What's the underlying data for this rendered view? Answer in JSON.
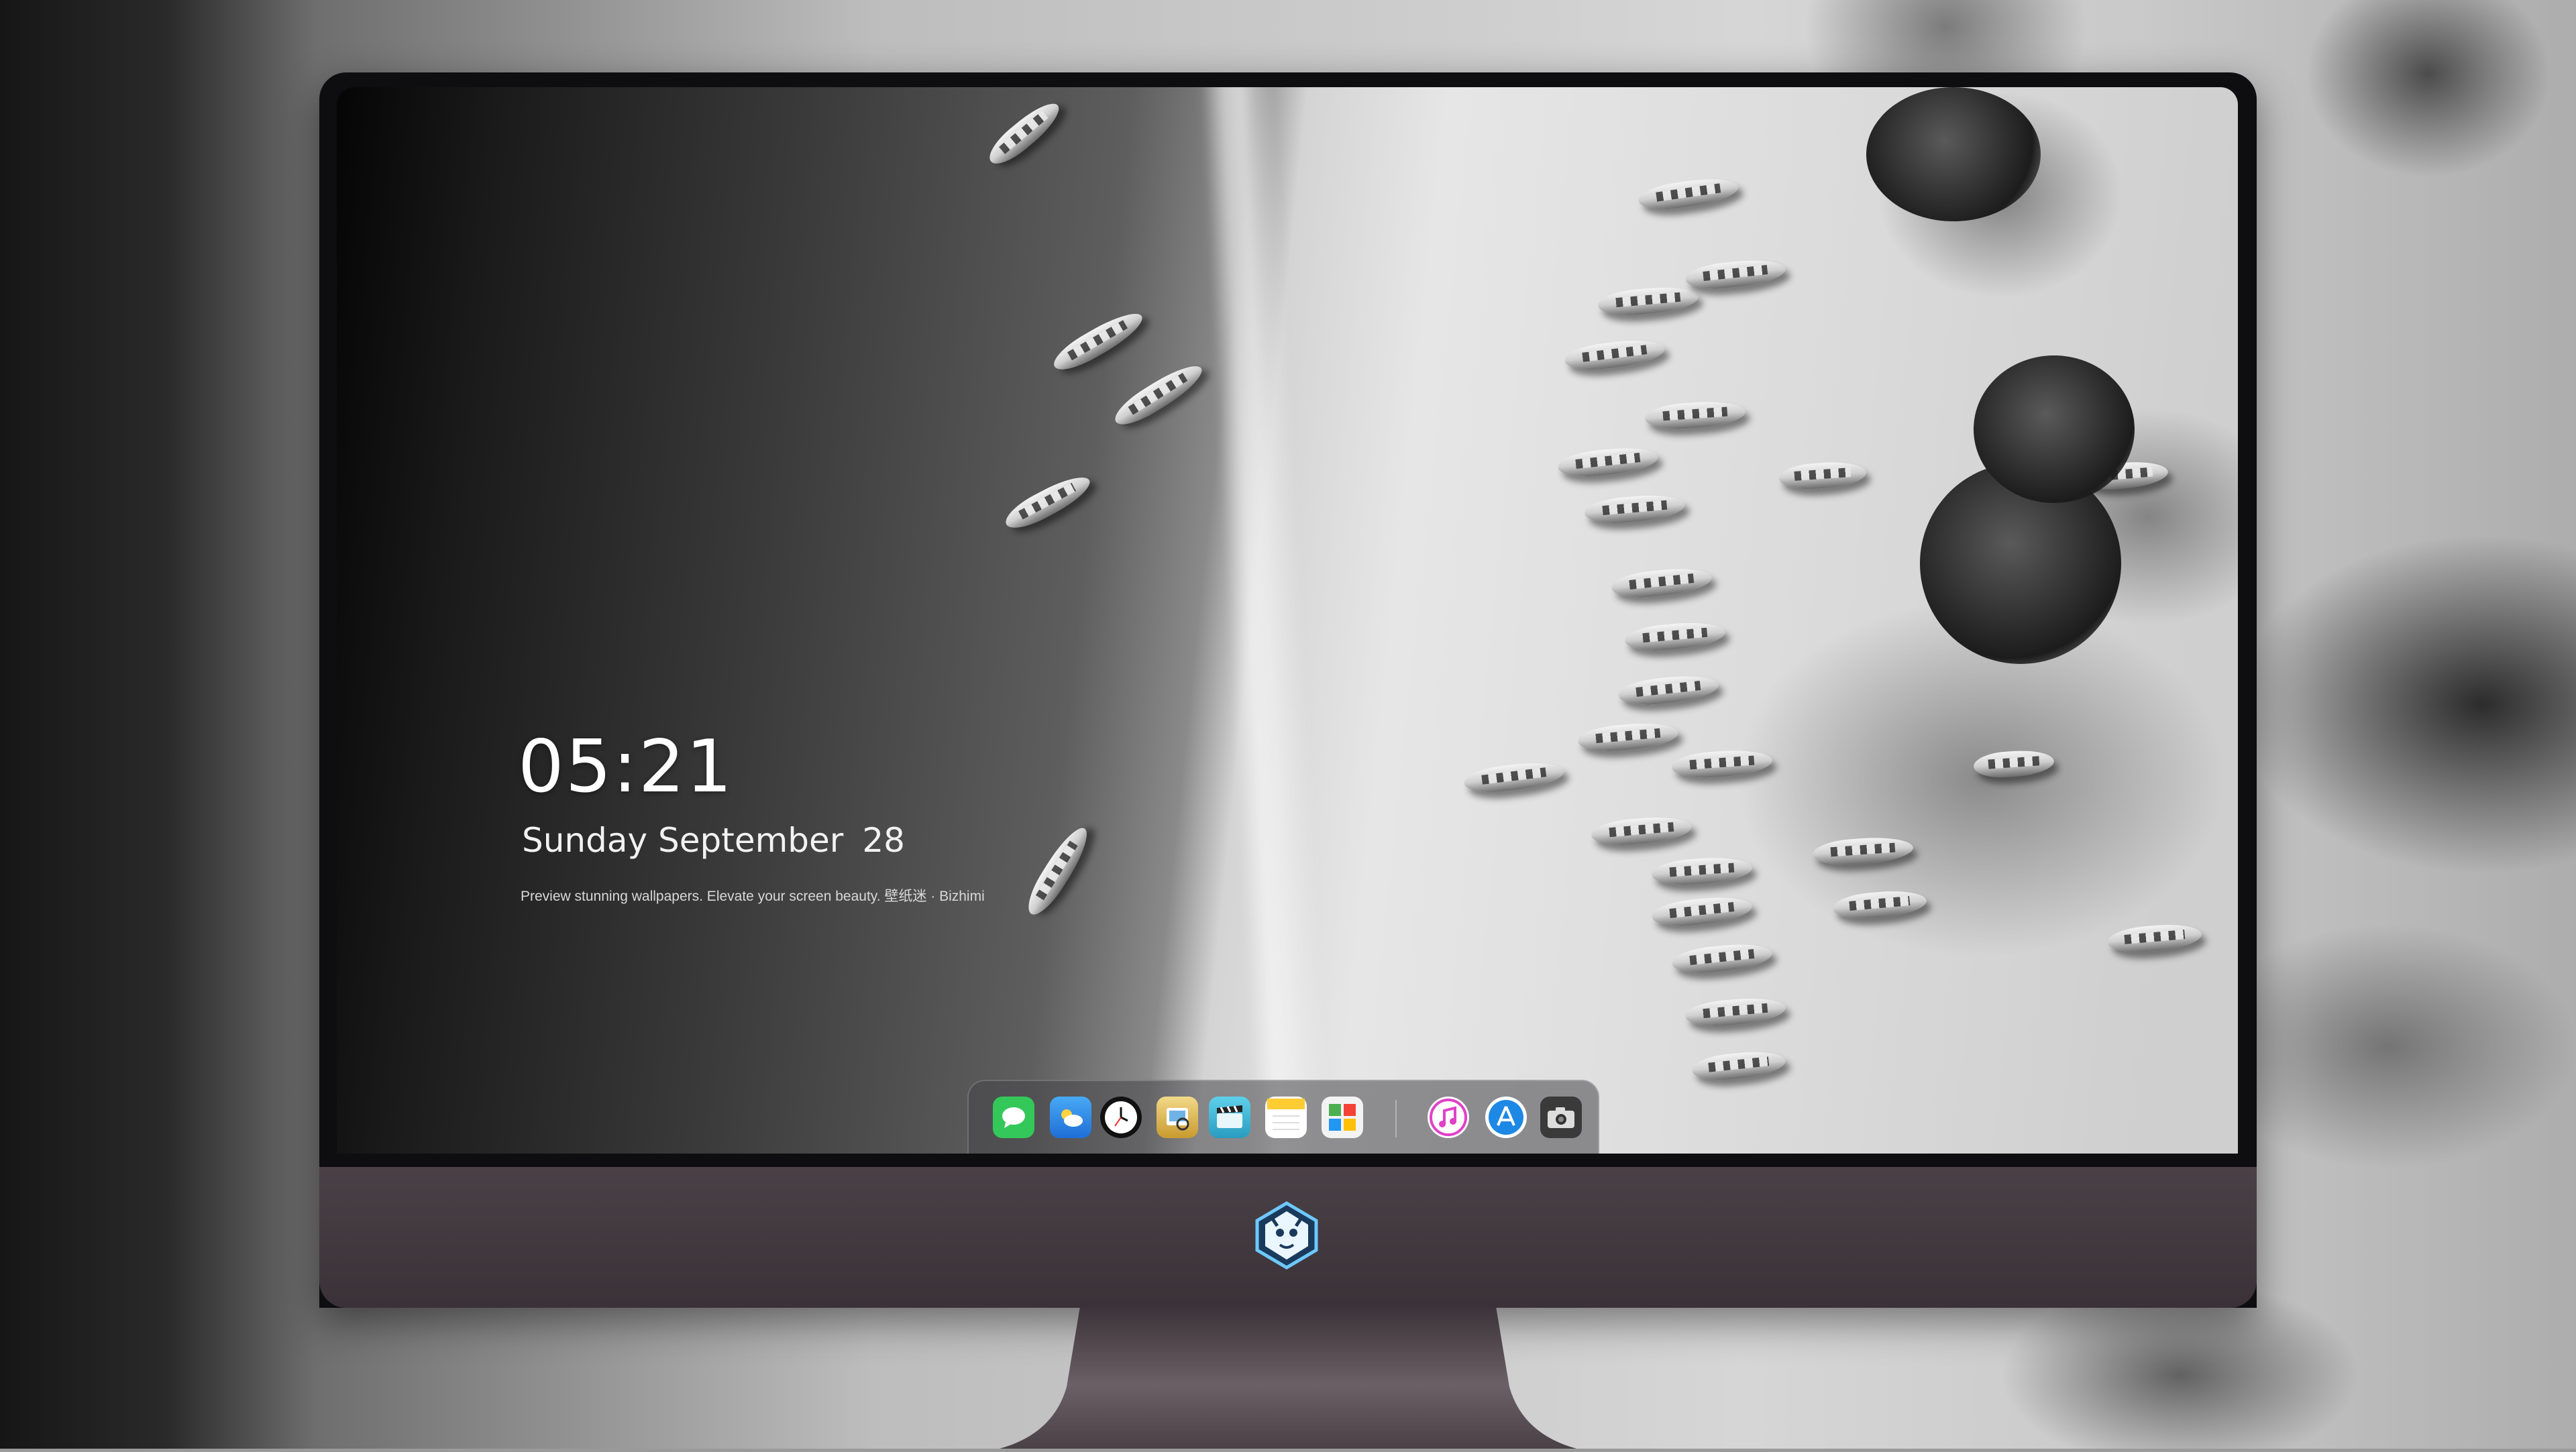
{
  "desktop": {
    "clock": {
      "time": "05:21",
      "weekday_month": "Sunday September",
      "day": "28"
    },
    "tagline": "Preview stunning wallpapers. Elevate your screen beauty. 壁纸迷 · Bizhimi"
  },
  "dock": {
    "apps": [
      {
        "icon": "messages-icon",
        "color": "#34c759"
      },
      {
        "icon": "weather-icon",
        "color": "#1e90ff"
      },
      {
        "icon": "clock-icon",
        "color": "#ffffff"
      },
      {
        "icon": "preview-icon",
        "color": "#e8c766"
      },
      {
        "icon": "clips-icon",
        "color": "#3fb8d8"
      },
      {
        "icon": "notes-icon",
        "color": "#ffd54a"
      },
      {
        "icon": "photo-booth-icon",
        "color": "#4caf50"
      },
      {
        "icon": "music-icon",
        "color": "#e040c8"
      },
      {
        "icon": "app-store-icon",
        "color": "#1e88e5"
      },
      {
        "icon": "camera-icon",
        "color": "#3a3a3a"
      }
    ]
  },
  "colors": {
    "bezel": "#0e0e10",
    "chin": "#453c42",
    "dock_background": "#464648"
  }
}
